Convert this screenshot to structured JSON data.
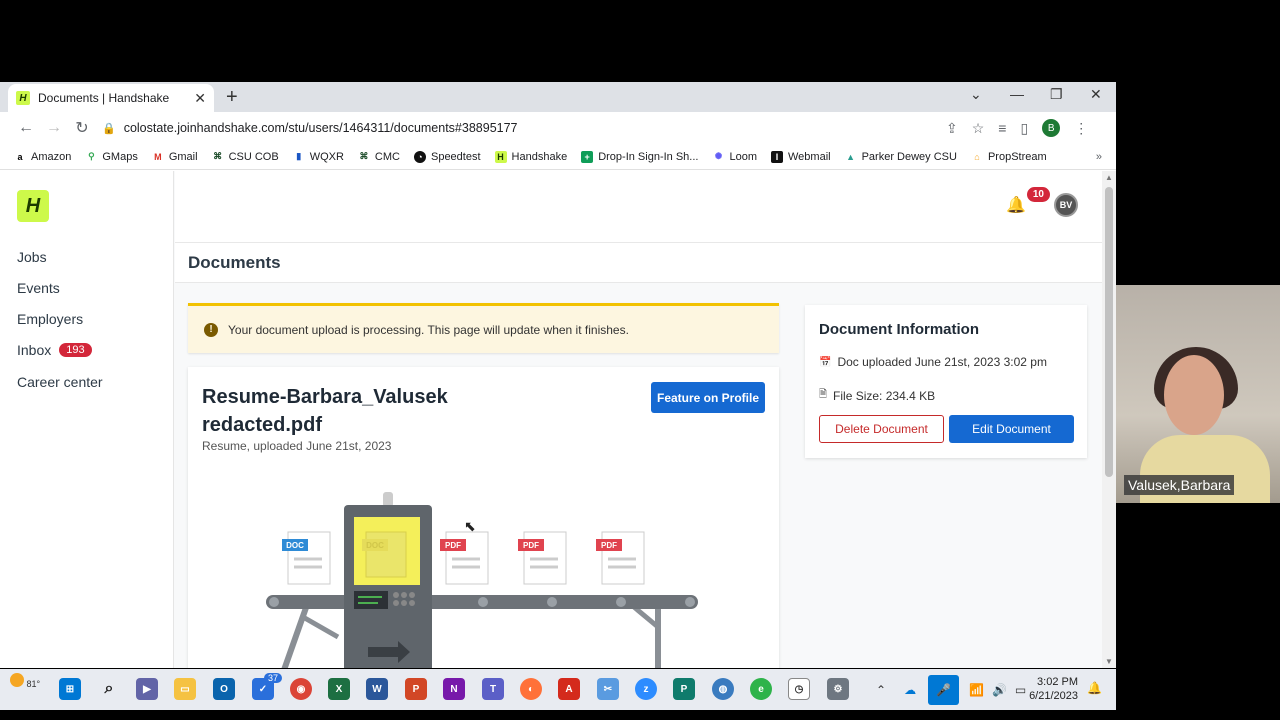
{
  "browser": {
    "tab_title": "Documents | Handshake",
    "url": "colostate.joinhandshake.com/stu/users/1464311/documents#38895177",
    "profile_initial": "B",
    "bookmarks": [
      "Amazon",
      "GMaps",
      "Gmail",
      "CSU COB",
      "WQXR",
      "CMC",
      "Speedtest",
      "Handshake",
      "Drop-In Sign-In Sh...",
      "Loom",
      "Webmail",
      "Parker Dewey CSU",
      "PropStream"
    ],
    "bookmarks_more": "»"
  },
  "nav": {
    "items": [
      "Jobs",
      "Events",
      "Employers",
      "Inbox",
      "Career center"
    ],
    "inbox_count": "193"
  },
  "header": {
    "notification_count": "10",
    "user_initials": "BV",
    "page_title": "Documents"
  },
  "alert": {
    "message": "Your document upload is processing. This page will update when it finishes."
  },
  "document": {
    "name": "Resume-Barbara_Valusek redacted.pdf",
    "meta": "Resume, uploaded June 21st, 2023",
    "feature_button": "Feature on Profile",
    "illustration_labels": [
      "DOC",
      "DOC",
      "PDF",
      "PDF",
      "PDF"
    ]
  },
  "info": {
    "title": "Document Information",
    "uploaded": "Doc uploaded June 21st, 2023 3:02 pm",
    "file_size": "File Size: 234.4 KB",
    "delete_button": "Delete Document",
    "edit_button": "Edit Document"
  },
  "webcam": {
    "name": "Valusek,Barbara"
  },
  "taskbar": {
    "temperature": "81°",
    "badge_count": "37",
    "time": "3:02 PM",
    "date": "6/21/2023"
  }
}
